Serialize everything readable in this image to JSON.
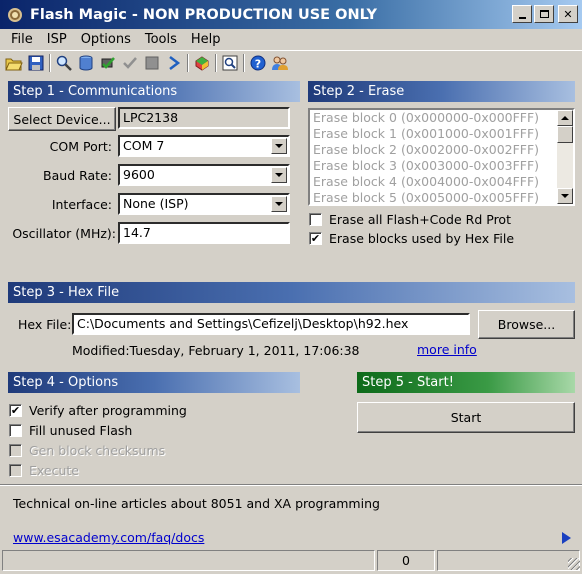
{
  "window": {
    "title": "Flash Magic - NON PRODUCTION USE ONLY"
  },
  "menu": [
    "File",
    "ISP",
    "Options",
    "Tools",
    "Help"
  ],
  "toolbar_icons": [
    "open-icon",
    "save-icon",
    "search-icon",
    "database-icon",
    "chip-check-icon",
    "check-icon",
    "stop-icon",
    "go-icon",
    "hex-icon",
    "view-icon",
    "help-icon",
    "users-icon"
  ],
  "step1": {
    "title": "Step 1 - Communications",
    "select_device_label": "Select Device...",
    "device": "LPC2138",
    "com_port_label": "COM Port:",
    "com_port": "COM 7",
    "baud_rate_label": "Baud Rate:",
    "baud_rate": "9600",
    "interface_label": "Interface:",
    "interface": "None (ISP)",
    "oscillator_label": "Oscillator (MHz):",
    "oscillator": "14.7"
  },
  "step2": {
    "title": "Step 2 - Erase",
    "blocks": [
      "Erase block 0 (0x000000-0x000FFF)",
      "Erase block 1 (0x001000-0x001FFF)",
      "Erase block 2 (0x002000-0x002FFF)",
      "Erase block 3 (0x003000-0x003FFF)",
      "Erase block 4 (0x004000-0x004FFF)",
      "Erase block 5 (0x005000-0x005FFF)"
    ],
    "erase_all_label": "Erase all Flash+Code Rd Prot",
    "erase_all_checked": false,
    "erase_used_label": "Erase blocks used by Hex File",
    "erase_used_checked": true
  },
  "step3": {
    "title": "Step 3 - Hex File",
    "hex_file_label": "Hex File:",
    "hex_file": "C:\\Documents and Settings\\Cefizelj\\Desktop\\h92.hex",
    "browse_label": "Browse...",
    "modified": "Modified:Tuesday, February 1, 2011, 17:06:38",
    "more_info": "more info"
  },
  "step4": {
    "title": "Step 4 - Options",
    "options": [
      {
        "label": "Verify after programming",
        "checked": true,
        "enabled": true
      },
      {
        "label": "Fill unused Flash",
        "checked": false,
        "enabled": true
      },
      {
        "label": "Gen block checksums",
        "checked": false,
        "enabled": false
      },
      {
        "label": "Execute",
        "checked": false,
        "enabled": false
      }
    ]
  },
  "step5": {
    "title": "Step 5 - Start!",
    "start_label": "Start"
  },
  "info": {
    "text": "Technical on-line articles about 8051 and XA programming",
    "link": "www.esacademy.com/faq/docs"
  },
  "status": {
    "count": "0"
  },
  "colors": {
    "title_bar": "#0a246a",
    "section_blue": "#1f3a7a",
    "section_green": "#0d6a1a",
    "link": "#0000cc"
  }
}
